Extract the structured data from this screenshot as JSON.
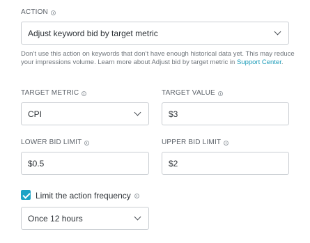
{
  "action": {
    "label": "ACTION",
    "selected": "Adjust keyword bid by target metric",
    "help_text": "Don’t use this action on keywords that don’t have enough historical data yet. This may reduce your impressions volume. Learn more about Adjust bid by target metric in ",
    "help_link": "Support Center",
    "help_end": "."
  },
  "target_metric": {
    "label": "TARGET METRIC",
    "selected": "CPI"
  },
  "target_value": {
    "label": "TARGET VALUE",
    "value": "$3"
  },
  "lower_bid_limit": {
    "label": "LOWER BID LIMIT",
    "value": "$0.5"
  },
  "upper_bid_limit": {
    "label": "UPPER BID LIMIT",
    "value": "$2"
  },
  "frequency": {
    "checkbox_label": "Limit the action frequency",
    "checked": true,
    "selected": "Once 12 hours"
  },
  "colors": {
    "accent": "#1ba3c6",
    "link": "#1a9bb8",
    "border": "#c9cdd2"
  },
  "icons": {
    "info": "info-icon",
    "dropdown": "chevron-down-icon",
    "check": "checkmark-icon"
  }
}
